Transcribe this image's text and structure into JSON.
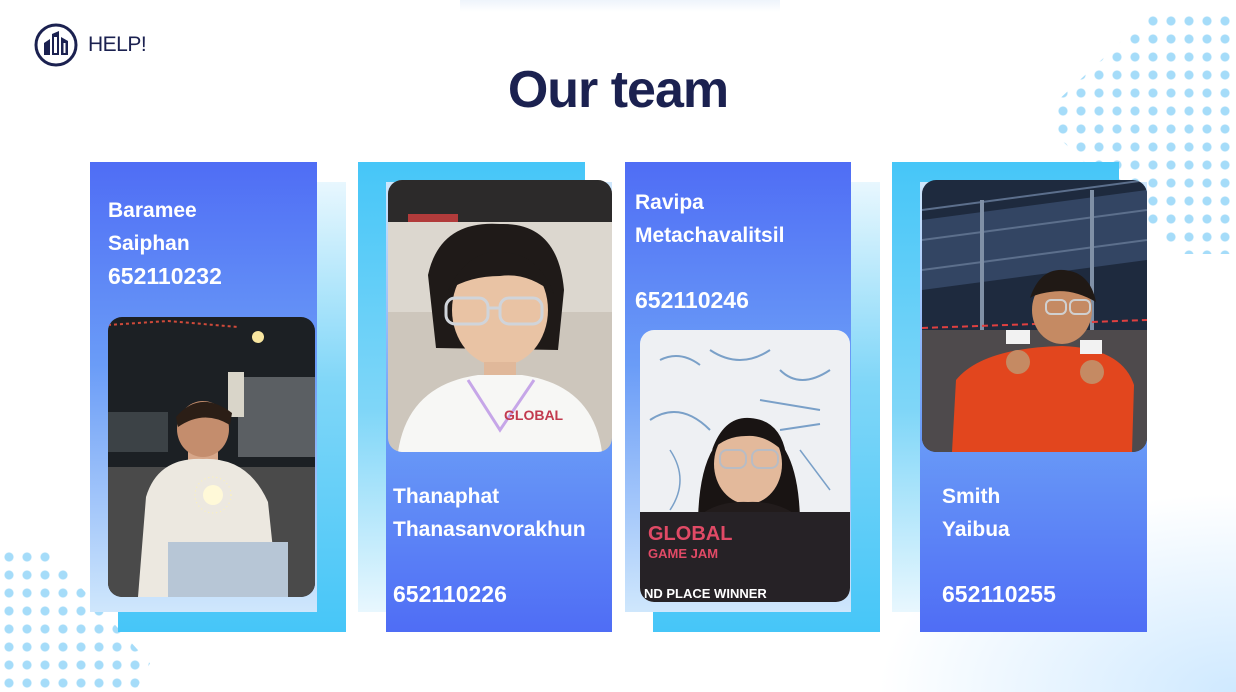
{
  "brand": {
    "name": "HELP!",
    "logo_icon": "building-logo-icon",
    "colors": {
      "navy": "#1b2150",
      "blue": "#4f6df5",
      "cyan": "#46c6f8"
    }
  },
  "page": {
    "title": "Our team"
  },
  "team": [
    {
      "first_name": "Baramee",
      "last_name": "Saiphan",
      "student_id": "652110232"
    },
    {
      "first_name": "Thanaphat",
      "last_name": "Thanasanvorakhun",
      "student_id": "652110226"
    },
    {
      "first_name": "Ravipa",
      "last_name": "Metachavalitsil",
      "student_id": "652110246"
    },
    {
      "first_name": "Smith",
      "last_name": "Yaibua",
      "student_id": "652110255"
    }
  ]
}
